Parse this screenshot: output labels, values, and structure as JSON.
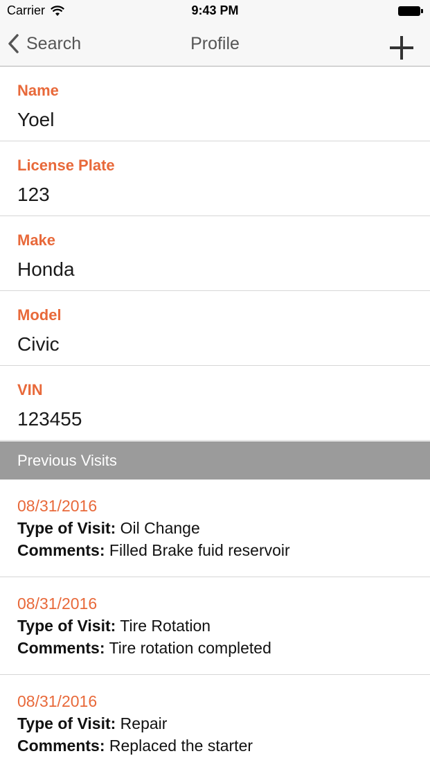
{
  "status_bar": {
    "carrier": "Carrier",
    "time": "9:43 PM"
  },
  "nav": {
    "back_label": "Search",
    "title": "Profile",
    "accent_color": "#e8693a"
  },
  "fields": [
    {
      "label": "Name",
      "value": "Yoel"
    },
    {
      "label": "License Plate",
      "value": "123"
    },
    {
      "label": "Make",
      "value": "Honda"
    },
    {
      "label": "Model",
      "value": "Civic"
    },
    {
      "label": "VIN",
      "value": "123455"
    }
  ],
  "section": {
    "title": "Previous Visits"
  },
  "visit_labels": {
    "type": "Type of Visit:",
    "comments": "Comments:"
  },
  "visits": [
    {
      "date": "08/31/2016",
      "type": "Oil Change",
      "comments": "Filled Brake fuid reservoir"
    },
    {
      "date": "08/31/2016",
      "type": "Tire Rotation",
      "comments": "Tire rotation completed"
    },
    {
      "date": "08/31/2016",
      "type": "Repair",
      "comments": "Replaced the starter"
    }
  ]
}
